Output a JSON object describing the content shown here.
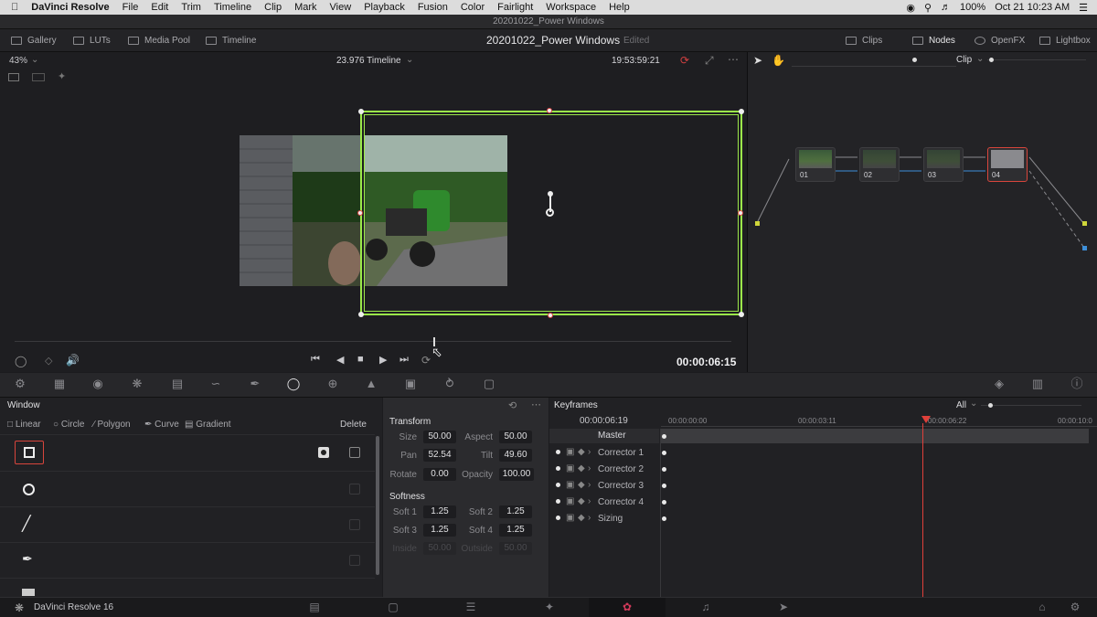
{
  "menubar": {
    "app": "DaVinci Resolve",
    "items": [
      "File",
      "Edit",
      "Trim",
      "Timeline",
      "Clip",
      "Mark",
      "View",
      "Playback",
      "Fusion",
      "Color",
      "Fairlight",
      "Workspace",
      "Help"
    ],
    "battery": "100%",
    "clock": "Oct 21  10:23 AM"
  },
  "window_title": "20201022_Power Windows",
  "toolbar": {
    "gallery": "Gallery",
    "luts": "LUTs",
    "media_pool": "Media Pool",
    "timeline": "Timeline",
    "project_name": "20201022_Power Windows",
    "edited": "Edited",
    "clips": "Clips",
    "nodes": "Nodes",
    "openfx": "OpenFX",
    "lightbox": "Lightbox"
  },
  "viewer": {
    "zoom": "43%",
    "timeline_name": "23.976 Timeline",
    "source_tc": "19:53:59:21",
    "timecode": "00:00:06:15"
  },
  "node_editor": {
    "mode": "Clip",
    "nodes": [
      "01",
      "02",
      "03",
      "04"
    ]
  },
  "window_panel": {
    "title": "Window",
    "tools": [
      "Linear",
      "Circle",
      "Polygon",
      "Curve",
      "Gradient"
    ],
    "delete": "Delete"
  },
  "transform": {
    "title": "Transform",
    "size_label": "Size",
    "size": "50.00",
    "aspect_label": "Aspect",
    "aspect": "50.00",
    "pan_label": "Pan",
    "pan": "52.54",
    "tilt_label": "Tilt",
    "tilt": "49.60",
    "rotate_label": "Rotate",
    "rotate": "0.00",
    "opacity_label": "Opacity",
    "opacity": "100.00",
    "softness_title": "Softness",
    "soft1_label": "Soft 1",
    "soft1": "1.25",
    "soft2_label": "Soft 2",
    "soft2": "1.25",
    "soft3_label": "Soft 3",
    "soft3": "1.25",
    "soft4_label": "Soft 4",
    "soft4": "1.25",
    "inside_label": "Inside",
    "inside": "50.00",
    "outside_label": "Outside",
    "outside": "50.00"
  },
  "keyframes": {
    "title": "Keyframes",
    "filter": "All",
    "current_tc": "00:00:06:19",
    "ruler": [
      "00:00:00:00",
      "00:00:03:11",
      "00:00:06:22",
      "00:00:10:0"
    ],
    "master": "Master",
    "tracks": [
      "Corrector 1",
      "Corrector 2",
      "Corrector 3",
      "Corrector 4",
      "Sizing"
    ]
  },
  "bottombar": {
    "app_label": "DaVinci Resolve 16"
  },
  "colors": {
    "accent_green": "#9be84a",
    "playhead_red": "#e0403a",
    "node_selected_border": "#d8453c",
    "page_active_underline": "#d23a5a"
  }
}
